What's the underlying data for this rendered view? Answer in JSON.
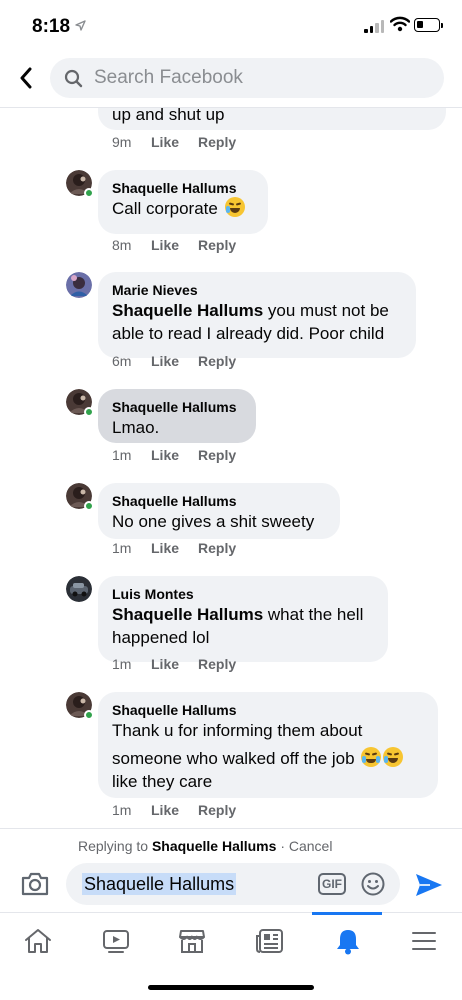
{
  "status_bar": {
    "time": "8:18"
  },
  "header": {
    "search_placeholder": "Search Facebook"
  },
  "comments": [
    {
      "author": "",
      "text": "up and shut up",
      "time": "9m",
      "like": "Like",
      "reply": "Reply"
    },
    {
      "author": "Shaquelle Hallums",
      "text": "Call corporate",
      "time": "8m",
      "like": "Like",
      "reply": "Reply"
    },
    {
      "author": "Marie Nieves",
      "mention": "Shaquelle Hallums",
      "text": " you must not be able to read I already did. Poor child",
      "time": "6m",
      "like": "Like",
      "reply": "Reply"
    },
    {
      "author": "Shaquelle Hallums",
      "text": "Lmao.",
      "time": "1m",
      "like": "Like",
      "reply": "Reply"
    },
    {
      "author": "Shaquelle Hallums",
      "text": "No one gives a shit sweety",
      "time": "1m",
      "like": "Like",
      "reply": "Reply"
    },
    {
      "author": "Luis Montes",
      "mention": "Shaquelle Hallums",
      "text": " what the hell happened lol",
      "time": "1m",
      "like": "Like",
      "reply": "Reply"
    },
    {
      "author": "Shaquelle Hallums",
      "text_line1": "Thank u for informing them about",
      "text_line2": "someone who walked off the job",
      "text_line3": "like they care",
      "time": "1m",
      "like": "Like",
      "reply": "Reply"
    }
  ],
  "reply_bar": {
    "replying_prefix": "Replying to",
    "replying_name": "Shaquelle Hallums",
    "cancel": "· Cancel",
    "input_value": "Shaquelle Hallums",
    "gif_label": "GIF"
  },
  "colors": {
    "accent": "#1877f2",
    "bubble": "#f0f2f5",
    "online": "#31a24c"
  },
  "icons": [
    "back-icon",
    "search-icon",
    "camera-icon",
    "gif-icon",
    "smile-icon",
    "send-icon",
    "home-icon",
    "watch-icon",
    "marketplace-icon",
    "news-icon",
    "bell-icon",
    "menu-icon"
  ]
}
